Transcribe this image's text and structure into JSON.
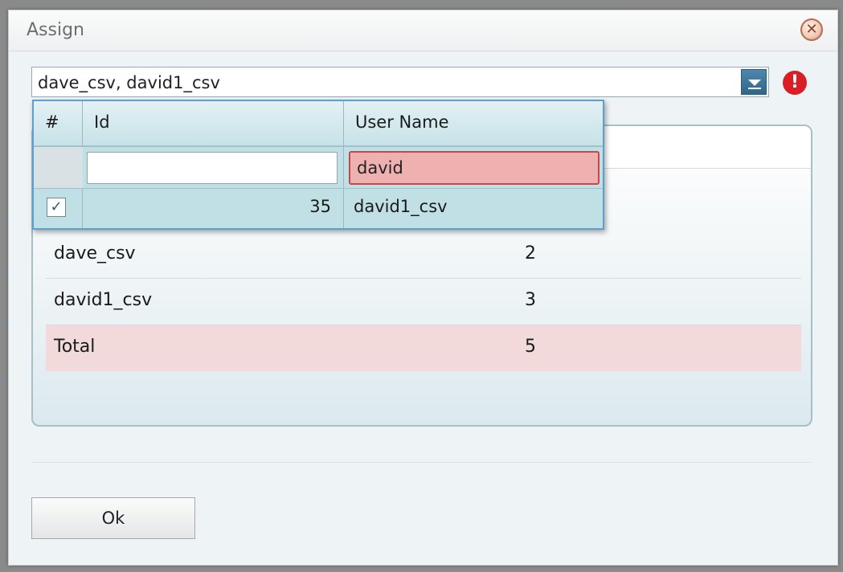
{
  "dialog": {
    "title": "Assign",
    "close_icon": "close-icon",
    "error_icon": "error-icon"
  },
  "combo": {
    "value": "dave_csv, david1_csv",
    "trigger_icon": "chevron-down-icon"
  },
  "dropdown": {
    "columns": [
      "#",
      "Id",
      "User Name"
    ],
    "filter": {
      "id_value": "",
      "user_name_value": "david"
    },
    "rows": [
      {
        "checked": true,
        "id": "35",
        "user_name": "david1_csv"
      }
    ]
  },
  "grid": {
    "rows": [
      {
        "name": "dave_csv",
        "value": "2"
      },
      {
        "name": "david1_csv",
        "value": "3"
      }
    ],
    "total": {
      "name": "Total",
      "value": "5"
    }
  },
  "buttons": {
    "ok_label": "Ok"
  },
  "colors": {
    "accent": "#2f6689",
    "error": "#d91f26",
    "filter_invalid": "#eeb1b0",
    "total_row": "#f2dadb",
    "dropdown_bg": "#c1e0e6"
  }
}
